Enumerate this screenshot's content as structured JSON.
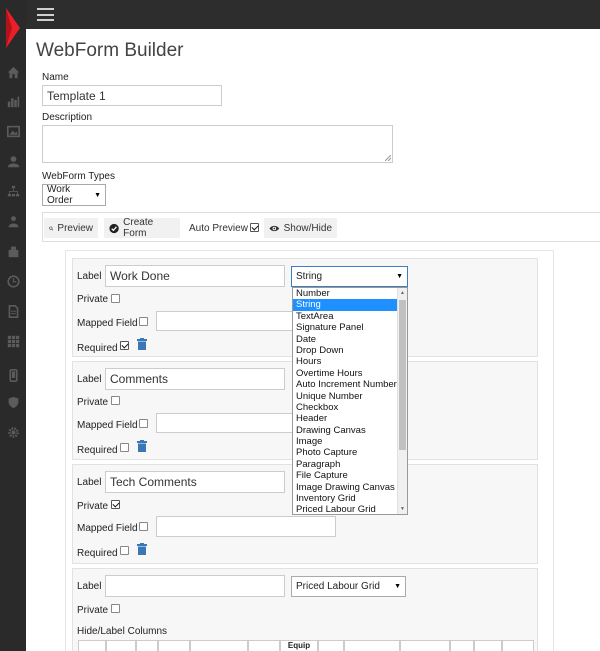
{
  "header": {
    "menu_icon": "hamburger-icon"
  },
  "sidebar": {
    "icons": [
      "logo-icon",
      "home-icon",
      "bar-chart-icon",
      "image-icon",
      "user-icon",
      "sitemap-icon",
      "user-group-icon",
      "building-icon",
      "clock-icon",
      "document-icon",
      "grid-icon",
      "mobile-icon",
      "shield-icon",
      "gear-icon"
    ]
  },
  "page": {
    "title": "WebForm Builder"
  },
  "form": {
    "name_label": "Name",
    "name_value": "Template 1",
    "description_label": "Description",
    "description_value": "",
    "types_label": "WebForm Types",
    "types_value": "Work Order"
  },
  "toolbar": {
    "preview": "Preview",
    "create_form": "Create Form",
    "auto_preview": "Auto Preview",
    "auto_preview_checked": true,
    "show_hide": "Show/Hide"
  },
  "fields": [
    {
      "label_caption": "Label",
      "label_value": "Work Done",
      "type_value": "String",
      "private_caption": "Private",
      "private": false,
      "mapped_caption": "Mapped Field",
      "mapped": false,
      "required_caption": "Required",
      "required": true
    },
    {
      "label_caption": "Label",
      "label_value": "Comments",
      "private_caption": "Private",
      "private": false,
      "mapped_caption": "Mapped Field",
      "mapped": false,
      "required_caption": "Required",
      "required": false
    },
    {
      "label_caption": "Label",
      "label_value": "Tech Comments",
      "private_caption": "Private",
      "private": true,
      "mapped_caption": "Mapped Field",
      "mapped": false,
      "required_caption": "Required",
      "required": false
    },
    {
      "label_caption": "Label",
      "label_value": "",
      "type_value": "Priced Labour Grid",
      "private_caption": "Private",
      "private": false,
      "hide_columns_caption": "Hide/Label Columns"
    }
  ],
  "type_dropdown": {
    "selected": "String",
    "options": [
      "Number",
      "String",
      "TextArea",
      "Signature Panel",
      "Date",
      "Drop Down",
      "Hours",
      "Overtime Hours",
      "Auto Increment Number",
      "Unique Number",
      "Checkbox",
      "Header",
      "Drawing Canvas",
      "Image",
      "Photo Capture",
      "Paragraph",
      "File Capture",
      "Image Drawing Canvas",
      "Inventory Grid",
      "Priced Labour Grid"
    ]
  },
  "grid_header": {
    "equip_label": "Equip"
  }
}
